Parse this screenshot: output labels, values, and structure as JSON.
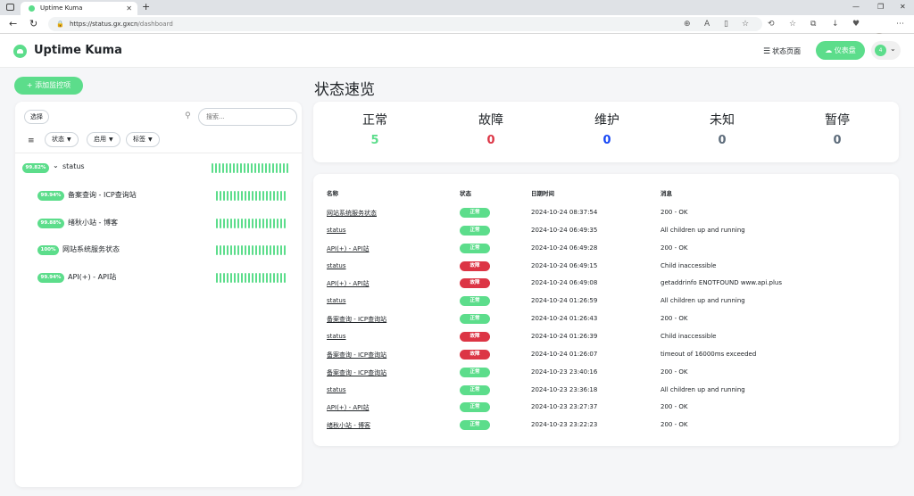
{
  "browser": {
    "tab_title": "Uptime Kuma",
    "url_host": "https://status.gx.gxcn",
    "url_path": "/dashboard"
  },
  "header": {
    "brand": "Uptime Kuma",
    "status_page_label": "状态页面",
    "dashboard_label": "仪表盘",
    "profile_count": "4"
  },
  "sidebar": {
    "add_button": "添加监控项",
    "select_label": "选择",
    "search_placeholder": "搜索...",
    "filters": [
      "状态",
      "启用",
      "标签"
    ],
    "monitors": [
      {
        "uptime": "99.82%",
        "name": "status",
        "group": true
      },
      {
        "uptime": "99.94%",
        "name": "备案查询 - ICP查询站",
        "group": false
      },
      {
        "uptime": "99.88%",
        "name": "绪秋小站 - 博客",
        "group": false
      },
      {
        "uptime": "100%",
        "name": "网站系统服务状态",
        "group": false
      },
      {
        "uptime": "99.94%",
        "name": "API(+) - API站",
        "group": false
      }
    ]
  },
  "main": {
    "title": "状态速览",
    "stats": [
      {
        "label": "正常",
        "value": "5",
        "color": "#5cdd8b"
      },
      {
        "label": "故障",
        "value": "0",
        "color": "#dc3545"
      },
      {
        "label": "维护",
        "value": "0",
        "color": "#1747f5"
      },
      {
        "label": "未知",
        "value": "0",
        "color": "#5c6b7a"
      },
      {
        "label": "暂停",
        "value": "0",
        "color": "#5c6b7a"
      }
    ],
    "table_headers": [
      "名称",
      "状态",
      "日期时间",
      "消息"
    ],
    "events": [
      {
        "name": "网站系统服务状态",
        "status": "正常",
        "up": true,
        "time": "2024-10-24 08:37:54",
        "msg": "200 - OK"
      },
      {
        "name": "status",
        "status": "正常",
        "up": true,
        "time": "2024-10-24 06:49:35",
        "msg": "All children up and running"
      },
      {
        "name": "API(+) - API站",
        "status": "正常",
        "up": true,
        "time": "2024-10-24 06:49:28",
        "msg": "200 - OK"
      },
      {
        "name": "status",
        "status": "故障",
        "up": false,
        "time": "2024-10-24 06:49:15",
        "msg": "Child inaccessible"
      },
      {
        "name": "API(+) - API站",
        "status": "故障",
        "up": false,
        "time": "2024-10-24 06:49:08",
        "msg": "getaddrinfo ENOTFOUND www.api.plus"
      },
      {
        "name": "status",
        "status": "正常",
        "up": true,
        "time": "2024-10-24 01:26:59",
        "msg": "All children up and running"
      },
      {
        "name": "备案查询 - ICP查询站",
        "status": "正常",
        "up": true,
        "time": "2024-10-24 01:26:43",
        "msg": "200 - OK"
      },
      {
        "name": "status",
        "status": "故障",
        "up": false,
        "time": "2024-10-24 01:26:39",
        "msg": "Child inaccessible"
      },
      {
        "name": "备案查询 - ICP查询站",
        "status": "故障",
        "up": false,
        "time": "2024-10-24 01:26:07",
        "msg": "timeout of 16000ms exceeded"
      },
      {
        "name": "备案查询 - ICP查询站",
        "status": "正常",
        "up": true,
        "time": "2024-10-23 23:40:16",
        "msg": "200 - OK"
      },
      {
        "name": "status",
        "status": "正常",
        "up": true,
        "time": "2024-10-23 23:36:18",
        "msg": "All children up and running"
      },
      {
        "name": "API(+) - API站",
        "status": "正常",
        "up": true,
        "time": "2024-10-23 23:27:37",
        "msg": "200 - OK"
      },
      {
        "name": "绪秋小站 - 博客",
        "status": "正常",
        "up": true,
        "time": "2024-10-23 23:22:23",
        "msg": "200 - OK"
      }
    ]
  },
  "colors": {
    "up": "#5cdd8b",
    "down": "#dc3545"
  }
}
